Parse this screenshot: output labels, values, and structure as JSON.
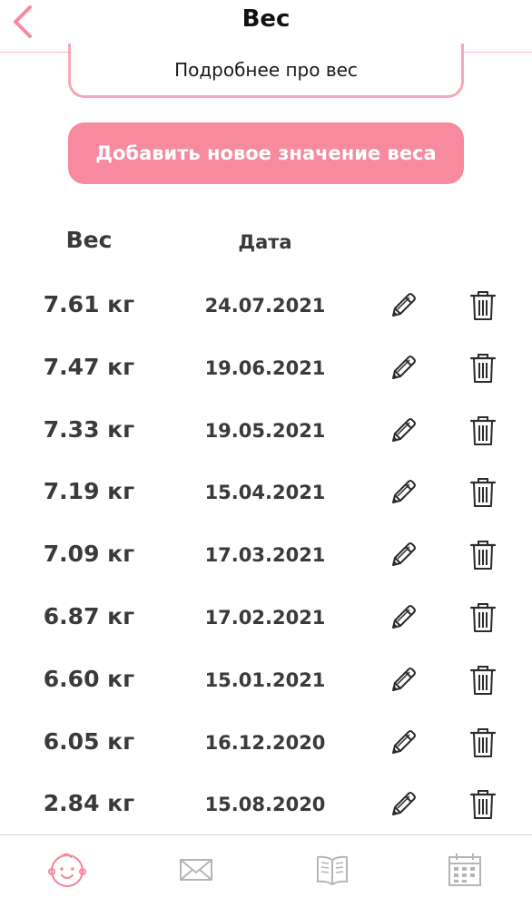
{
  "header": {
    "title": "Вес",
    "back_icon": "chevron-left-icon"
  },
  "buttons": {
    "more_label": "Подробнее про вес",
    "add_label": "Добавить новое значение веса"
  },
  "table": {
    "columns": [
      "Вес",
      "Дата"
    ],
    "rows": [
      {
        "weight": "7.61 кг",
        "date": "24.07.2021"
      },
      {
        "weight": "7.47 кг",
        "date": "19.06.2021"
      },
      {
        "weight": "7.33 кг",
        "date": "19.05.2021"
      },
      {
        "weight": "7.19 кг",
        "date": "15.04.2021"
      },
      {
        "weight": "7.09 кг",
        "date": "17.03.2021"
      },
      {
        "weight": "6.87 кг",
        "date": "17.02.2021"
      },
      {
        "weight": "6.60 кг",
        "date": "15.01.2021"
      },
      {
        "weight": "6.05 кг",
        "date": "16.12.2020"
      },
      {
        "weight": "2.84 кг",
        "date": "15.08.2020"
      }
    ],
    "row_icons": {
      "edit": "pencil-icon",
      "delete": "trash-icon"
    }
  },
  "tabbar": {
    "tabs": [
      {
        "icon": "baby-face-icon",
        "active": true
      },
      {
        "icon": "envelope-icon",
        "active": false
      },
      {
        "icon": "book-icon",
        "active": false
      },
      {
        "icon": "calendar-icon",
        "active": false
      }
    ]
  },
  "colors": {
    "accent": "#f78a9e",
    "accent_light": "#f5a8b8",
    "text": "#3a3a3a",
    "inactive_icon": "#b5b5b5"
  }
}
